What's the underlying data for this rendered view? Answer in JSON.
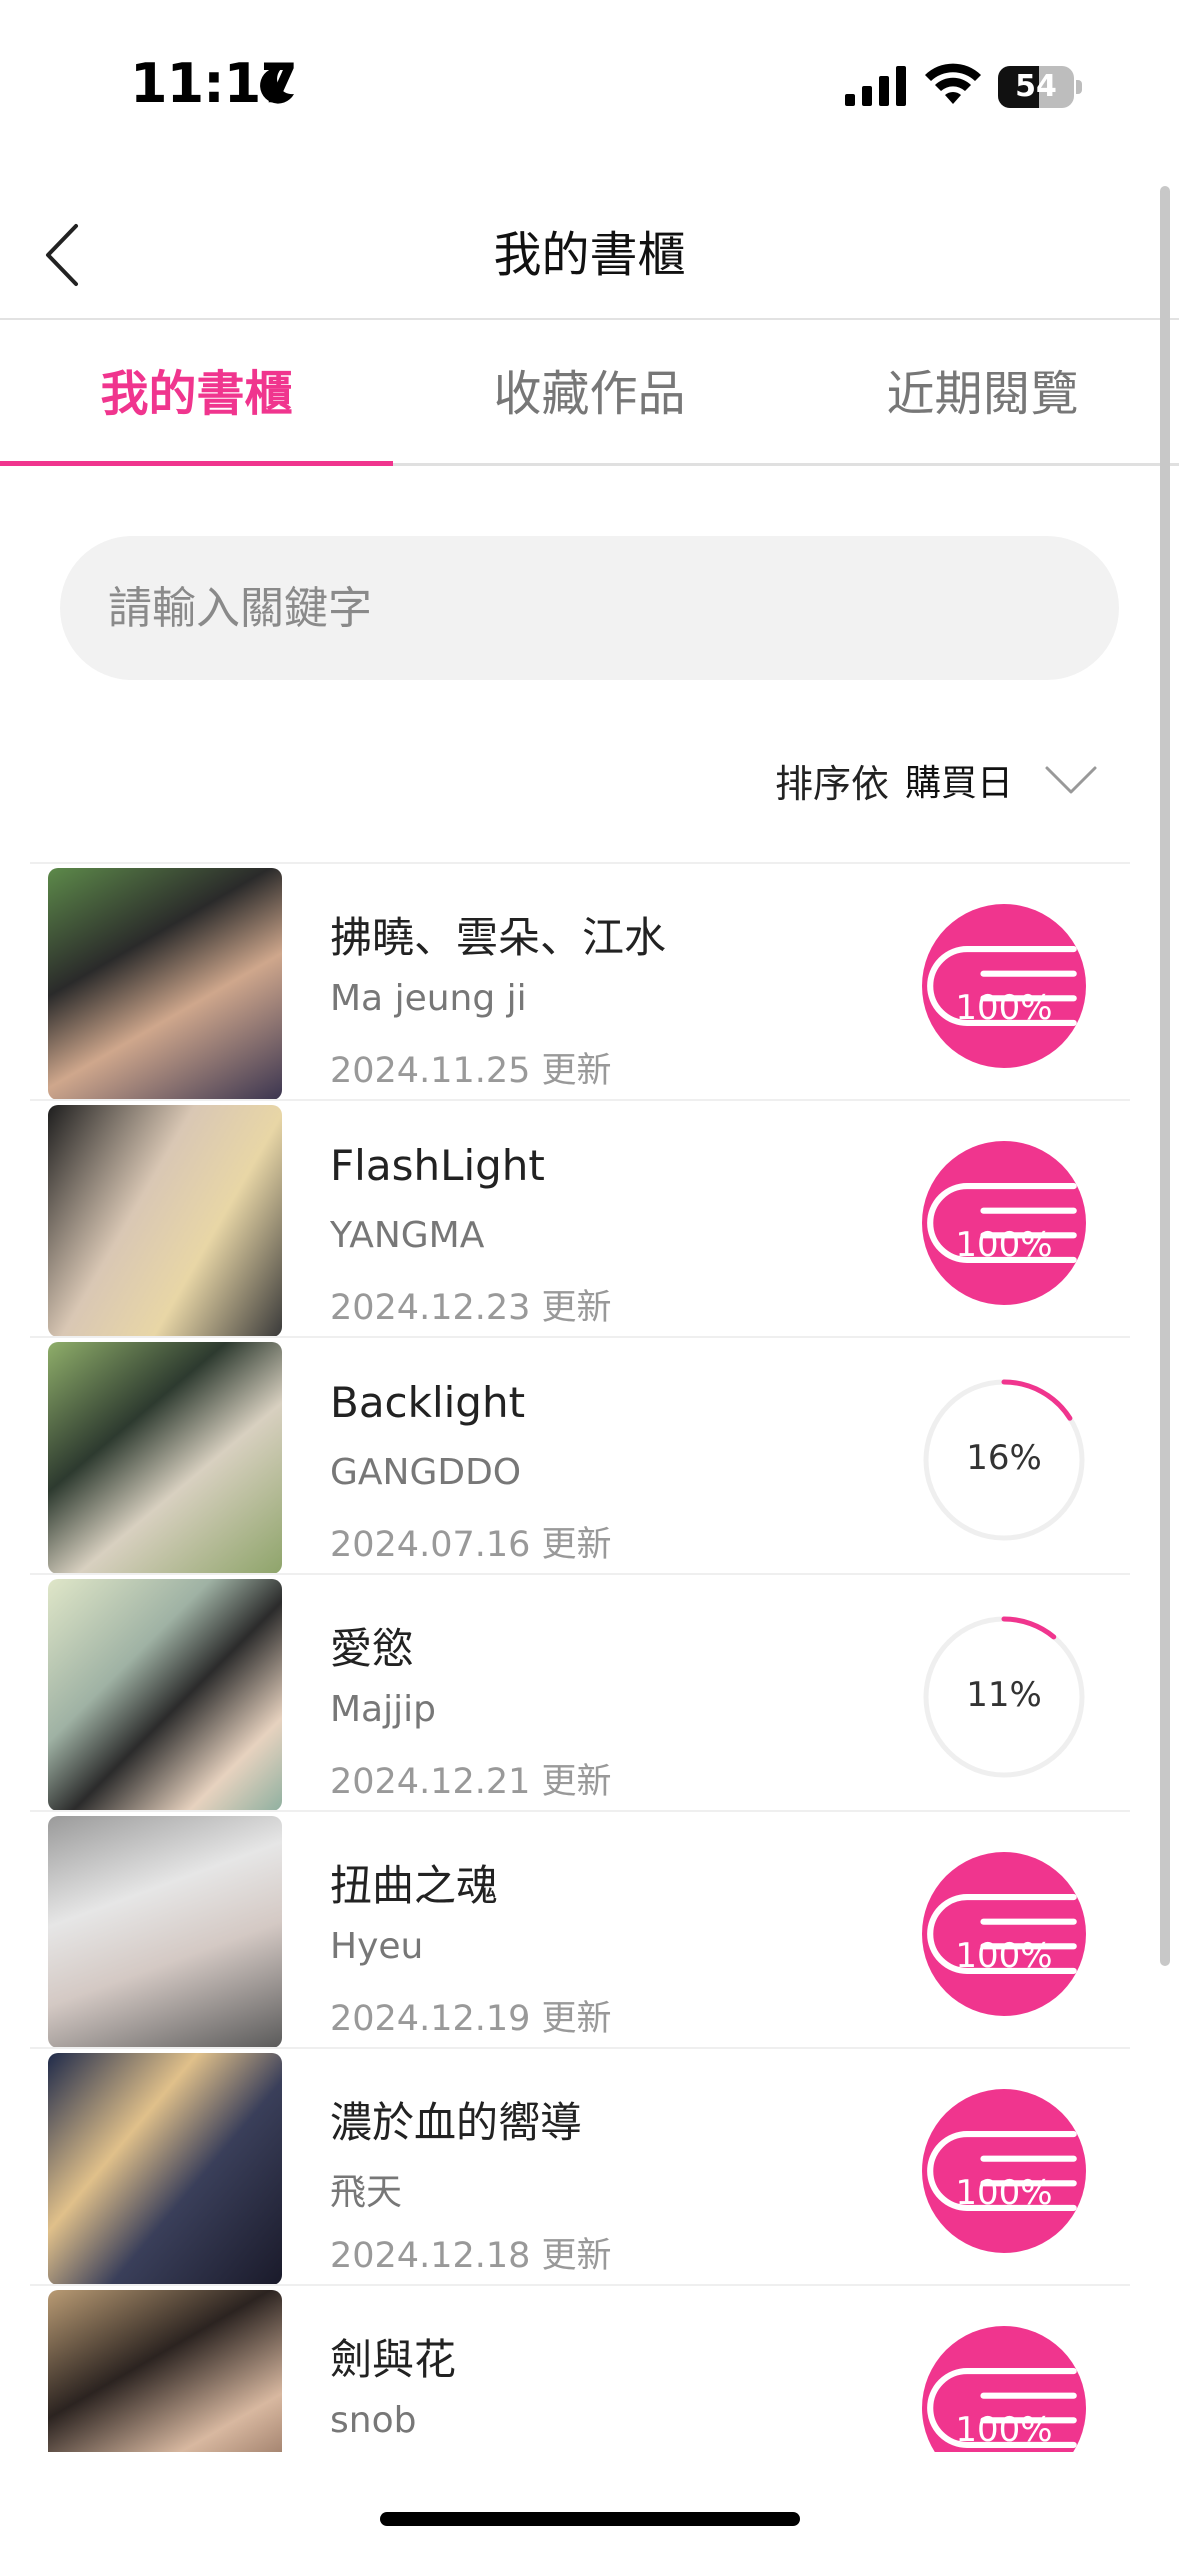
{
  "status_bar": {
    "time": "11:17",
    "battery": "54",
    "battery_level": 0.54
  },
  "nav": {
    "title": "我的書櫃",
    "back_icon": "chevron-left-icon"
  },
  "tabs": [
    {
      "label": "我的書櫃",
      "active": true
    },
    {
      "label": "收藏作品",
      "active": false
    },
    {
      "label": "近期閱覽",
      "active": false
    }
  ],
  "search": {
    "placeholder": "請輸入關鍵字",
    "value": ""
  },
  "sort": {
    "label": "排序依",
    "value": "購買日"
  },
  "colors": {
    "accent": "#f0358e",
    "progress_track": "#efefef"
  },
  "books": [
    {
      "title": "拂曉、雲朵、江水",
      "author": "Ma jeung ji",
      "date": "2024.11.25 更新",
      "progress": 100,
      "progress_label": "100%"
    },
    {
      "title": "FlashLight",
      "author": "YANGMA",
      "date": "2024.12.23 更新",
      "progress": 100,
      "progress_label": "100%"
    },
    {
      "title": "Backlight",
      "author": "GANGDDO",
      "date": "2024.07.16 更新",
      "progress": 16,
      "progress_label": "16%"
    },
    {
      "title": "愛慾",
      "author": "Majjip",
      "date": "2024.12.21 更新",
      "progress": 11,
      "progress_label": "11%"
    },
    {
      "title": "扭曲之魂",
      "author": "Hyeu",
      "date": "2024.12.19 更新",
      "progress": 100,
      "progress_label": "100%"
    },
    {
      "title": "濃於血的嚮導",
      "author": "飛天",
      "date": "2024.12.18 更新",
      "progress": 100,
      "progress_label": "100%"
    },
    {
      "title": "劍與花",
      "author": "snob",
      "date": "",
      "progress": 100,
      "progress_label": "100%"
    }
  ]
}
